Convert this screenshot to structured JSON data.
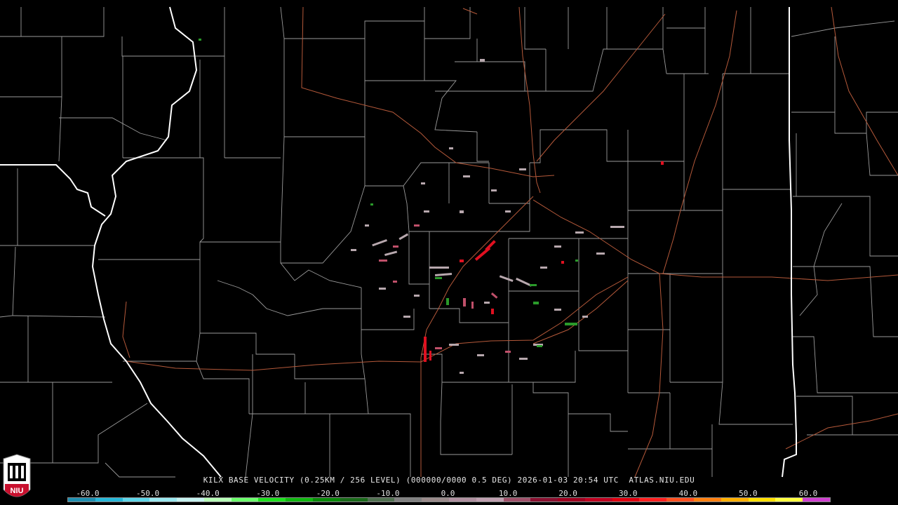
{
  "title": "KILX BASE VELOCITY (0.25KM / 256 LEVEL) (000000/0000 0.5 DEG) 2026-01-03 20:54 UTC  ATLAS.NIU.EDU",
  "logo_text": "NIU",
  "scale_labels": [
    "-60.0",
    "-50.0",
    "-40.0",
    "-30.0",
    "-20.0",
    "-10.0",
    "0.0",
    "10.0",
    "20.0",
    "30.0",
    "40.0",
    "50.0",
    "60.0"
  ],
  "colors": {
    "background": "#000000",
    "county_lines": "#9a9a9a",
    "state_lines": "#ffffff",
    "highways": "#b5593a",
    "logo_red": "#c8102e"
  },
  "colorbar": [
    "#1f8fb0",
    "#27b7d8",
    "#5fd6e8",
    "#9be8f0",
    "#c6f2f0",
    "#b8ffb8",
    "#6cff6c",
    "#1fe01f",
    "#11b811",
    "#0a8a0a",
    "#1a6a1a",
    "#507050",
    "#808080",
    "#9a8a8a",
    "#b090a0",
    "#c0a0b0",
    "#a0506a",
    "#8a1030",
    "#a00020",
    "#c00020",
    "#e00010",
    "#ff2020",
    "#ff5020",
    "#ff8010",
    "#ffb000",
    "#ffe000",
    "#ffff40",
    "#d040d0"
  ]
}
